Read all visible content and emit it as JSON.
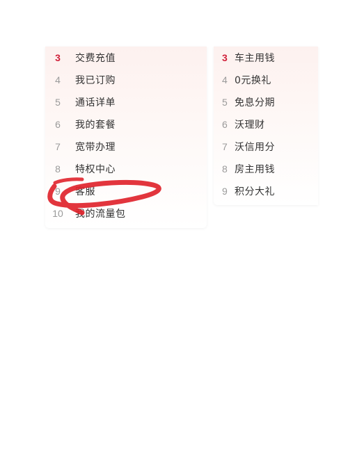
{
  "left_list": {
    "items": [
      {
        "rank": "3",
        "label": "交费充值",
        "hot": true
      },
      {
        "rank": "4",
        "label": "我已订购",
        "hot": false
      },
      {
        "rank": "5",
        "label": "通话详单",
        "hot": false
      },
      {
        "rank": "6",
        "label": "我的套餐",
        "hot": false
      },
      {
        "rank": "7",
        "label": "宽带办理",
        "hot": false
      },
      {
        "rank": "8",
        "label": "特权中心",
        "hot": false
      },
      {
        "rank": "9",
        "label": "客服",
        "hot": false
      },
      {
        "rank": "10",
        "label": "我的流量包",
        "hot": false
      }
    ]
  },
  "right_list": {
    "items": [
      {
        "rank": "3",
        "label": "车主用钱",
        "hot": true
      },
      {
        "rank": "4",
        "label": "0元换礼",
        "hot": false
      },
      {
        "rank": "5",
        "label": "免息分期",
        "hot": false
      },
      {
        "rank": "6",
        "label": "沃理财",
        "hot": false
      },
      {
        "rank": "7",
        "label": "沃信用分",
        "hot": false
      },
      {
        "rank": "8",
        "label": "房主用钱",
        "hot": false
      },
      {
        "rank": "9",
        "label": "积分大礼",
        "hot": false
      }
    ]
  },
  "colors": {
    "hot_rank": "#d0203a",
    "normal_rank": "#9a9a9a",
    "label_text": "#333333",
    "annotation_stroke": "#e0242c"
  }
}
